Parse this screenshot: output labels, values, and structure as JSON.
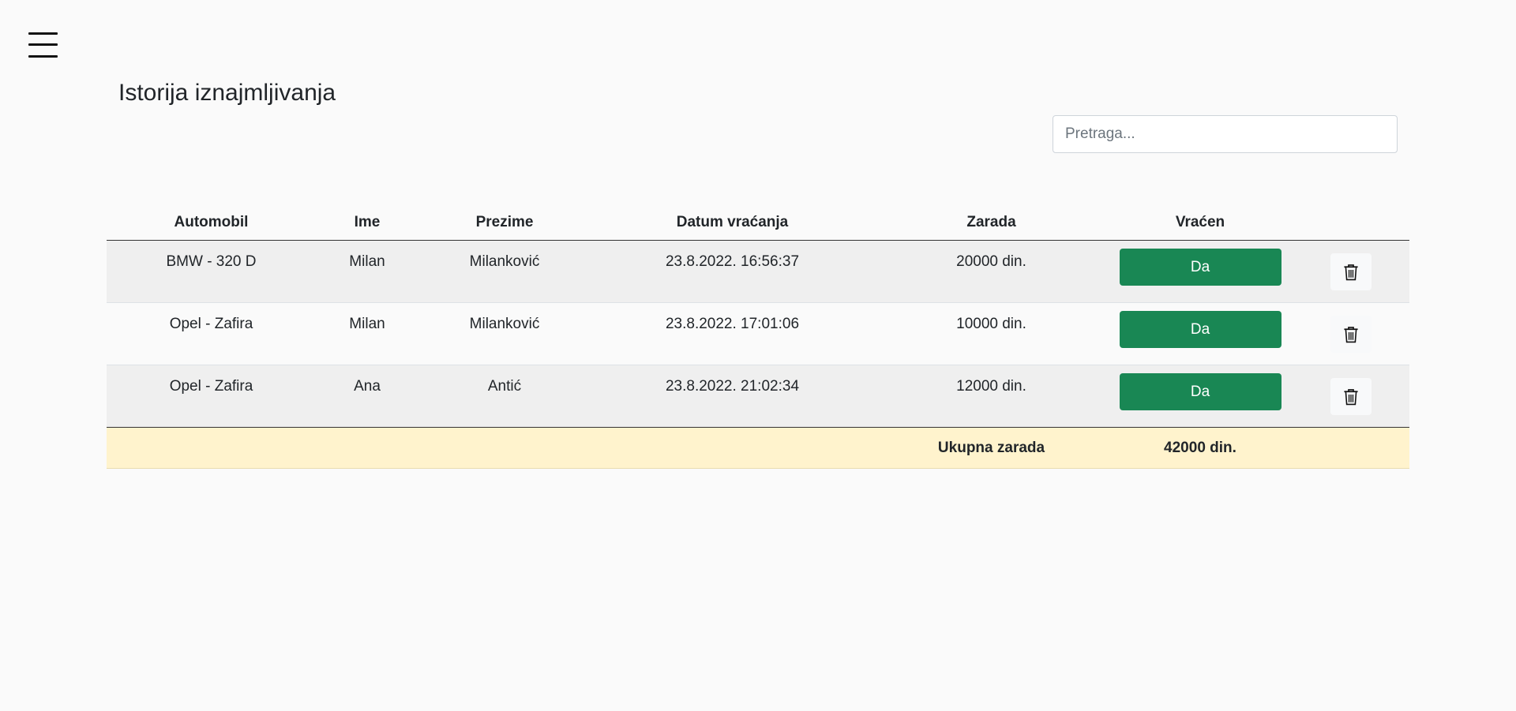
{
  "page": {
    "title": "Istorija iznajmljivanja"
  },
  "search": {
    "placeholder": "Pretraga...",
    "value": ""
  },
  "table": {
    "headers": {
      "car": "Automobil",
      "first_name": "Ime",
      "last_name": "Prezime",
      "return_date": "Datum vraćanja",
      "earnings": "Zarada",
      "returned": "Vraćen"
    },
    "rows": [
      {
        "car": "BMW - 320 D",
        "first_name": "Milan",
        "last_name": "Milanković",
        "return_date": "23.8.2022. 16:56:37",
        "earnings": "20000 din.",
        "returned": "Da"
      },
      {
        "car": "Opel - Zafira",
        "first_name": "Milan",
        "last_name": "Milanković",
        "return_date": "23.8.2022. 17:01:06",
        "earnings": "10000 din.",
        "returned": "Da"
      },
      {
        "car": "Opel - Zafira",
        "first_name": "Ana",
        "last_name": "Antić",
        "return_date": "23.8.2022. 21:02:34",
        "earnings": "12000 din.",
        "returned": "Da"
      }
    ],
    "footer": {
      "label": "Ukupna zarada",
      "total": "42000 din."
    }
  },
  "icons": {
    "menu": "hamburger-menu-icon",
    "delete": "trash-icon"
  },
  "colors": {
    "returned_button": "#198754",
    "footer_background": "#fff3cd",
    "striped_row": "#efefef"
  }
}
